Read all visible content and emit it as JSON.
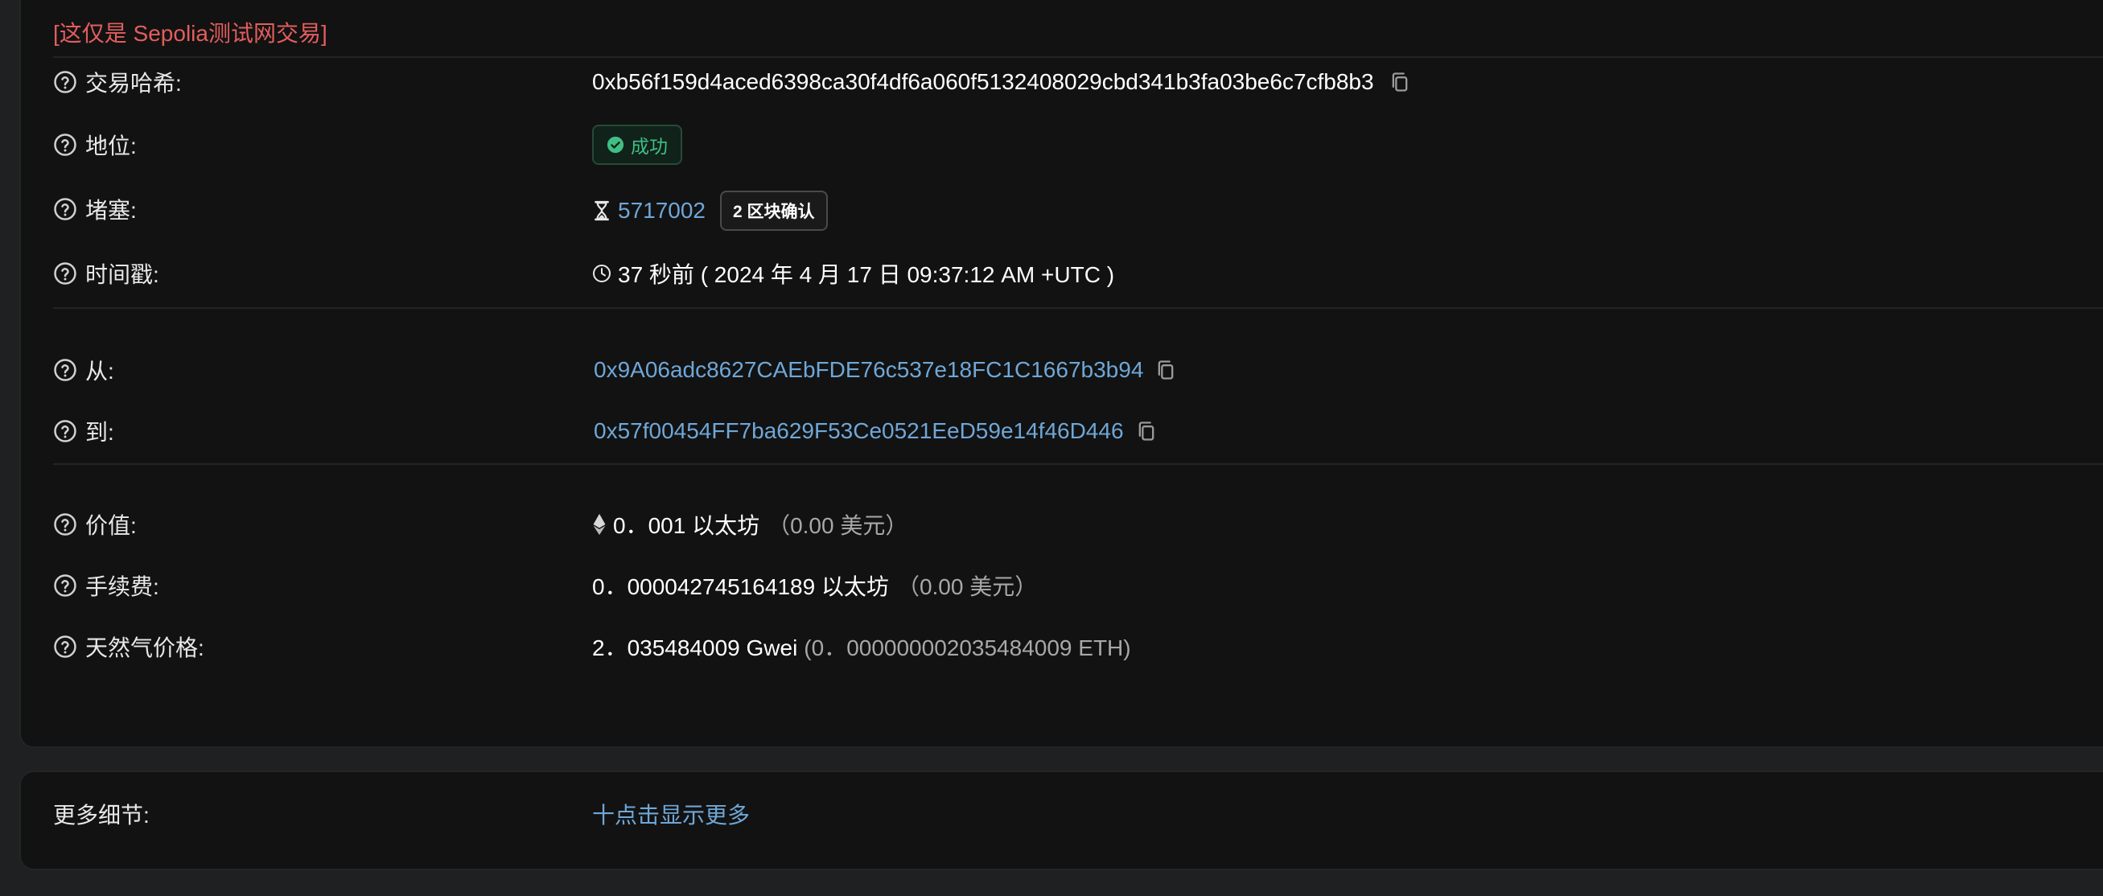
{
  "notice": "[这仅是 Sepolia测试网交易]",
  "rows": {
    "tx_hash": {
      "label": "交易哈希:",
      "value": "0xb56f159d4aced6398ca30f4df6a060f5132408029cbd341b3fa03be6c7cfb8b3"
    },
    "status": {
      "label": "地位:",
      "value": "成功"
    },
    "block": {
      "label": "堵塞:",
      "number": "5717002",
      "confirmations": "2 区块确认"
    },
    "timestamp": {
      "label": "时间戳:",
      "value": "37 秒前 ( 2024 年 4 月 17 日 09:37:12 AM +UTC )"
    },
    "from": {
      "label": "从:",
      "value": "0x9A06adc8627CAEbFDE76c537e18FC1C1667b3b94"
    },
    "to": {
      "label": "到:",
      "value": "0x57f00454FF7ba629F53Ce0521EeD59e14f46D446"
    },
    "value": {
      "label": "价值:",
      "amount": "0．001 以太坊",
      "usd": "（0.00 美元）"
    },
    "fee": {
      "label": "手续费:",
      "amount": "0．000042745164189 以太坊",
      "usd": "（0.00 美元）"
    },
    "gas_price": {
      "label": "天然气价格:",
      "gwei": "2．035484009 Gwei",
      "eth": "(0．000000002035484009 ETH)"
    }
  },
  "more": {
    "label": "更多细节:",
    "toggle": "十点击显示更多"
  },
  "icons": {
    "help": "question-circle-icon",
    "copy": "copy-icon",
    "success": "check-circle-icon",
    "block": "hourglass-icon",
    "time": "clock-icon",
    "eth": "ethereum-icon"
  },
  "colors": {
    "background": "#121212",
    "link": "#6fa7d7",
    "notice": "#e35d5d",
    "success": "#3fbf84"
  }
}
